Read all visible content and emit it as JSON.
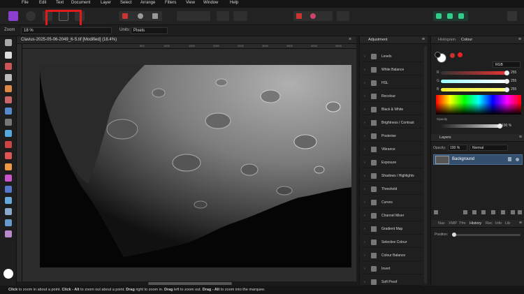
{
  "menubar": {
    "items": [
      "File",
      "Edit",
      "Text",
      "Document",
      "Layer",
      "Select",
      "Arrange",
      "Filters",
      "View",
      "Window",
      "Help"
    ]
  },
  "context_bar": {
    "zoom_label": "Zoom",
    "zoom_value": "18 %",
    "units_label": "Units:",
    "units_value": "Pixels"
  },
  "document": {
    "title": "Clavius-2025-05-06-2049_6-S.tif [Modified] (18.4%)",
    "ruler_ticks": [
      "500",
      "1000",
      "1500",
      "2000",
      "2500",
      "3000",
      "3500",
      "4000",
      "4500"
    ]
  },
  "adjustment_panel": {
    "tab": "Adjustment",
    "items": [
      "Levels",
      "White Balance",
      "HSL",
      "Recolour",
      "Black & White",
      "Brightness / Contrast",
      "Posterise",
      "Vibrance",
      "Exposure",
      "Shadows / Highlights",
      "Threshold",
      "Curves",
      "Channel Mixer",
      "Gradient Map",
      "Selective Colour",
      "Colour Balance",
      "Invert",
      "Soft Proof"
    ]
  },
  "colour_panel": {
    "tabs": [
      "Histogram",
      "Colour"
    ],
    "mode": "RGB",
    "channels": [
      {
        "name": "R",
        "value": "255",
        "color": "#e33"
      },
      {
        "name": "G",
        "value": "255",
        "color": "#3c3"
      },
      {
        "name": "B",
        "value": "255",
        "color": "#ee3"
      }
    ],
    "opacity_label": "Opacity",
    "opacity_value": "100 %"
  },
  "layers_panel": {
    "tab": "Layers",
    "opacity_label": "Opacity:",
    "opacity_value": "100 %",
    "blend_mode": "Normal",
    "layer_name": "Background"
  },
  "history_panel": {
    "tabs": [
      "Nav",
      "XMP",
      "Tfm",
      "History",
      "Rec",
      "Info",
      "Lib"
    ],
    "position_label": "Position:"
  },
  "status_bar": {
    "parts": [
      "Click",
      " to zoom in about a point. ",
      "Click - Alt",
      " to zoom out about a point. ",
      "Drag",
      " right to zoom in. ",
      "Drag",
      " left to zoom out. ",
      "Drag - Alt",
      " to zoom into the marquee."
    ]
  },
  "colors": {
    "accent": "#4a6f99",
    "highlight_box": "#e11b1b",
    "app_icon": "#8b3fcf"
  }
}
